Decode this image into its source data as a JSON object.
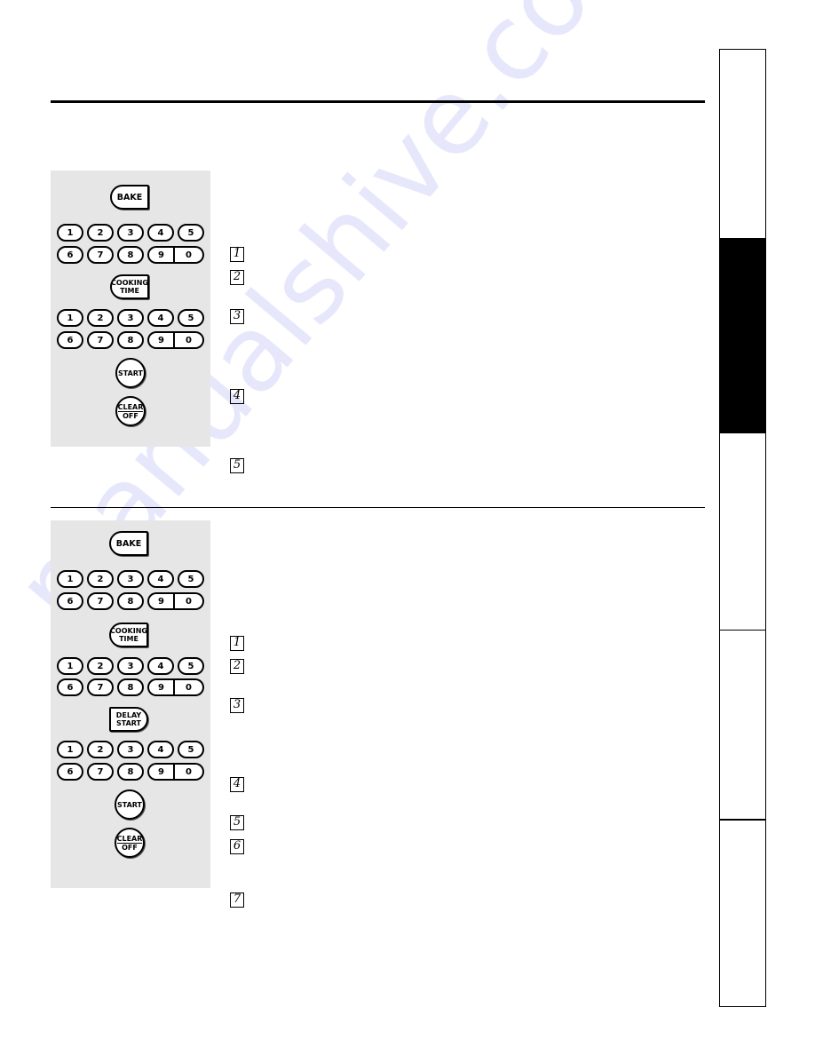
{
  "watermark": "manualshive.com",
  "section1": {
    "panel_buttons": {
      "bake": "BAKE",
      "cooking_time_line1": "COOKING",
      "cooking_time_line2": "TIME",
      "start": "START",
      "clear_line1": "CLEAR",
      "clear_line2": "OFF"
    },
    "keypad_row1": [
      "1",
      "2",
      "3",
      "4",
      "5"
    ],
    "keypad_row2": [
      "6",
      "7",
      "8",
      "9",
      "0"
    ],
    "steps": [
      "1",
      "2",
      "3",
      "4",
      "5"
    ]
  },
  "section2": {
    "panel_buttons": {
      "bake": "BAKE",
      "cooking_time_line1": "COOKING",
      "cooking_time_line2": "TIME",
      "delay_start_line1": "DELAY",
      "delay_start_line2": "START",
      "start": "START",
      "clear_line1": "CLEAR",
      "clear_line2": "OFF"
    },
    "keypad_row1": [
      "1",
      "2",
      "3",
      "4",
      "5"
    ],
    "keypad_row2": [
      "6",
      "7",
      "8",
      "9",
      "0"
    ],
    "steps": [
      "1",
      "2",
      "3",
      "4",
      "5",
      "6",
      "7"
    ]
  },
  "side_tabs": {
    "active_index": 1,
    "count": 5
  }
}
